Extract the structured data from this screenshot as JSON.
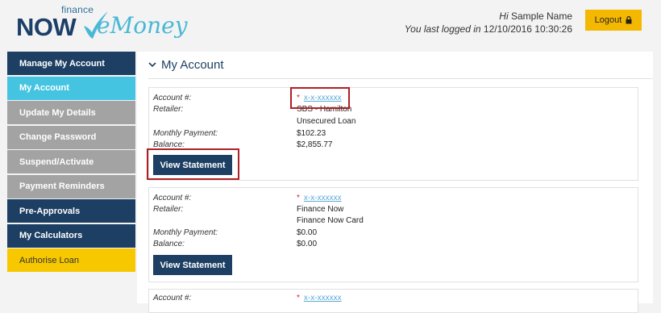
{
  "brand": {
    "finance": "finance",
    "now": "NOW",
    "emoney": "eMoney"
  },
  "header": {
    "greeting_prefix": "Hi",
    "user_name": "Sample Name",
    "last_login_prefix": "You last logged in",
    "last_login": "12/10/2016 10:30:26",
    "logout_label": "Logout",
    "logout_icon": "lock-icon"
  },
  "sidebar": {
    "items": [
      {
        "label": "Manage My Account"
      },
      {
        "label": "My Account"
      },
      {
        "label": "Update My Details"
      },
      {
        "label": "Change Password"
      },
      {
        "label": "Suspend/Activate"
      },
      {
        "label": "Payment Reminders"
      },
      {
        "label": "Pre-Approvals"
      },
      {
        "label": "My Calculators"
      },
      {
        "label": "Authorise Loan"
      }
    ]
  },
  "main": {
    "title": "My Account",
    "labels": {
      "account": "Account #:",
      "retailer": "Retailer:",
      "monthly_payment": "Monthly Payment:",
      "balance": "Balance:"
    },
    "view_statement_label": "View Statement",
    "accounts": [
      {
        "star": "*",
        "number": "x-x-xxxxxx",
        "retailer": "SBS - Hamilton",
        "product": "Unsecured Loan",
        "monthly_payment": "$102.23",
        "balance": "$2,855.77"
      },
      {
        "star": "*",
        "number": "x-x-xxxxxx",
        "retailer": "Finance Now",
        "product": "Finance Now Card",
        "monthly_payment": "$0.00",
        "balance": "$0.00"
      },
      {
        "star": "*",
        "number": "x-x-xxxxxx"
      }
    ]
  },
  "colors": {
    "navy": "#1d3f63",
    "active": "#45c4e2",
    "grey": "#a3a3a3",
    "gold": "#f7c800",
    "logout": "#f5b800",
    "highlight": "#b01f24"
  }
}
